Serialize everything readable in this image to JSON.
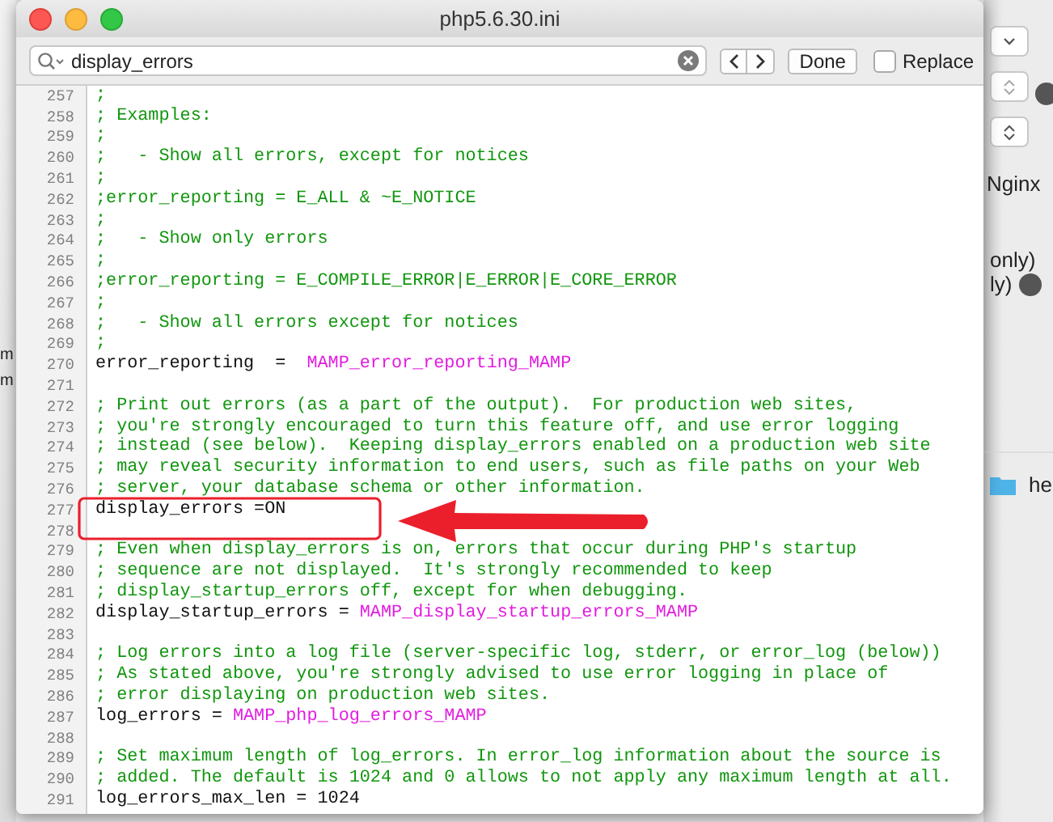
{
  "window": {
    "title": "php5.6.30.ini"
  },
  "find_bar": {
    "query": "display_errors",
    "done": "Done",
    "replace": {
      "label": "Replace",
      "checked": false
    }
  },
  "lines": [
    {
      "number": "257",
      "parts": [
        {
          "kind": "comment",
          "text": ";"
        }
      ]
    },
    {
      "number": "258",
      "parts": [
        {
          "kind": "comment",
          "text": "; Examples:"
        }
      ]
    },
    {
      "number": "259",
      "parts": [
        {
          "kind": "comment",
          "text": ";"
        }
      ]
    },
    {
      "number": "260",
      "parts": [
        {
          "kind": "comment",
          "text": ";   - Show all errors, except for notices"
        }
      ]
    },
    {
      "number": "261",
      "parts": [
        {
          "kind": "comment",
          "text": ";"
        }
      ]
    },
    {
      "number": "262",
      "parts": [
        {
          "kind": "comment",
          "text": ";error_reporting = E_ALL & ~E_NOTICE"
        }
      ]
    },
    {
      "number": "263",
      "parts": [
        {
          "kind": "comment",
          "text": ";"
        }
      ]
    },
    {
      "number": "264",
      "parts": [
        {
          "kind": "comment",
          "text": ";   - Show only errors"
        }
      ]
    },
    {
      "number": "265",
      "parts": [
        {
          "kind": "comment",
          "text": ";"
        }
      ]
    },
    {
      "number": "266",
      "parts": [
        {
          "kind": "comment",
          "text": ";error_reporting = E_COMPILE_ERROR|E_ERROR|E_CORE_ERROR"
        }
      ]
    },
    {
      "number": "267",
      "parts": [
        {
          "kind": "comment",
          "text": ";"
        }
      ]
    },
    {
      "number": "268",
      "parts": [
        {
          "kind": "comment",
          "text": ";   - Show all errors except for notices"
        }
      ]
    },
    {
      "number": "269",
      "parts": [
        {
          "kind": "comment",
          "text": ";"
        }
      ]
    },
    {
      "number": "270",
      "parts": [
        {
          "kind": "key",
          "text": "error_reporting  =  "
        },
        {
          "kind": "value",
          "text": "MAMP_error_reporting_MAMP"
        }
      ]
    },
    {
      "number": "271"
    },
    {
      "number": "272",
      "parts": [
        {
          "kind": "comment",
          "text": "; Print out errors (as a part of the output).  For production web sites,"
        }
      ]
    },
    {
      "number": "273",
      "parts": [
        {
          "kind": "comment",
          "text": "; you're strongly encouraged to turn this feature off, and use error logging"
        }
      ]
    },
    {
      "number": "274",
      "parts": [
        {
          "kind": "comment",
          "text": "; instead (see below).  Keeping display_errors enabled on a production web site"
        }
      ]
    },
    {
      "number": "275",
      "parts": [
        {
          "kind": "comment",
          "text": "; may reveal security information to end users, such as file paths on your Web"
        }
      ]
    },
    {
      "number": "276",
      "parts": [
        {
          "kind": "comment",
          "text": "; server, your database schema or other information."
        }
      ]
    },
    {
      "number": "277",
      "parts": [
        {
          "kind": "key",
          "text": "display_errors =ON"
        }
      ]
    },
    {
      "number": "278"
    },
    {
      "number": "279",
      "parts": [
        {
          "kind": "comment",
          "text": "; Even when display_errors is on, errors that occur during PHP's startup"
        }
      ]
    },
    {
      "number": "280",
      "parts": [
        {
          "kind": "comment",
          "text": "; sequence are not displayed.  It's strongly recommended to keep"
        }
      ]
    },
    {
      "number": "281",
      "parts": [
        {
          "kind": "comment",
          "text": "; display_startup_errors off, except for when debugging."
        }
      ]
    },
    {
      "number": "282",
      "parts": [
        {
          "kind": "key",
          "text": "display_startup_errors = "
        },
        {
          "kind": "value",
          "text": "MAMP_display_startup_errors_MAMP"
        }
      ]
    },
    {
      "number": "283"
    },
    {
      "number": "284",
      "parts": [
        {
          "kind": "comment",
          "text": "; Log errors into a log file (server-specific log, stderr, or error_log (below))"
        }
      ]
    },
    {
      "number": "285",
      "parts": [
        {
          "kind": "comment",
          "text": "; As stated above, you're strongly advised to use error logging in place of"
        }
      ]
    },
    {
      "number": "286",
      "parts": [
        {
          "kind": "comment",
          "text": "; error displaying on production web sites."
        }
      ]
    },
    {
      "number": "287",
      "parts": [
        {
          "kind": "key",
          "text": "log_errors = "
        },
        {
          "kind": "value",
          "text": "MAMP_php_log_errors_MAMP"
        }
      ]
    },
    {
      "number": "288"
    },
    {
      "number": "289",
      "parts": [
        {
          "kind": "comment",
          "text": "; Set maximum length of log_errors. In error_log information about the source is"
        }
      ]
    },
    {
      "number": "290",
      "parts": [
        {
          "kind": "comment",
          "text": "; added. The default is 1024 and 0 allows to not apply any maximum length at all."
        }
      ]
    },
    {
      "number": "291",
      "parts": [
        {
          "kind": "key",
          "text": "log_errors_max_len = 1024"
        }
      ]
    }
  ],
  "background_left": [
    "m",
    "m"
  ],
  "background_right": {
    "server": "Nginx",
    "option_1": "only)",
    "option_2": "ly)",
    "folder": "he"
  }
}
